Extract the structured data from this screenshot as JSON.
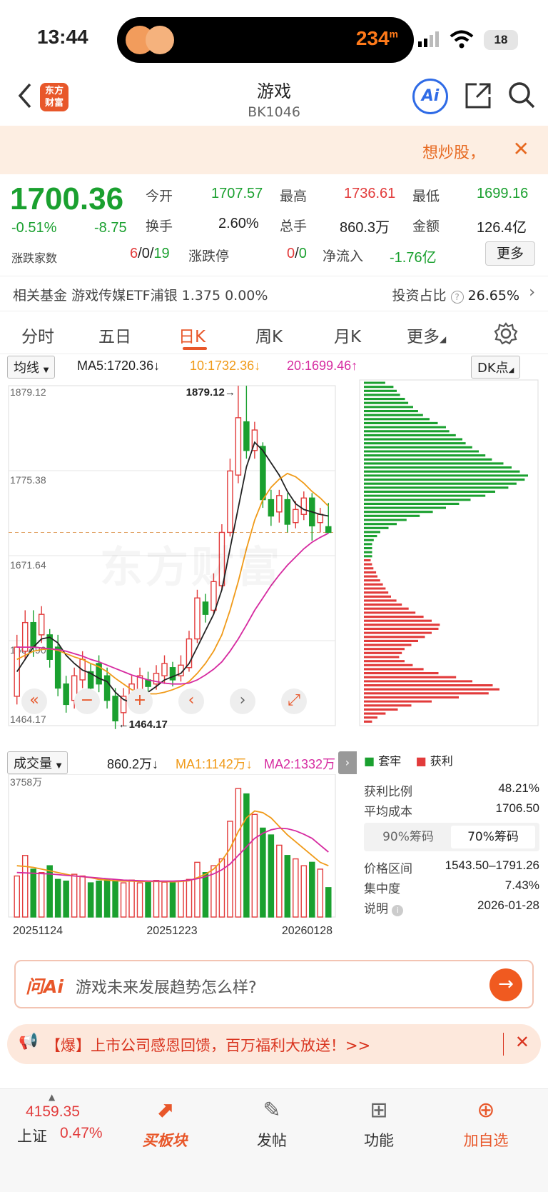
{
  "status_bar": {
    "time": "13:44",
    "speed": "234",
    "speed_unit": "m",
    "battery": "18"
  },
  "nav": {
    "title": "游戏",
    "code": "BK1046",
    "logo_line1": "东方",
    "logo_line2": "财富",
    "ai_label": "Ai"
  },
  "banner": {
    "text": "想炒股，",
    "close": "✕"
  },
  "quote": {
    "price": "1700.36",
    "change_pct": "-0.51%",
    "change": "-8.75",
    "open_label": "今开",
    "open": "1707.57",
    "high_label": "最高",
    "high": "1736.61",
    "low_label": "最低",
    "low": "1699.16",
    "turnover_label": "换手",
    "turnover": "2.60%",
    "volume_label": "总手",
    "volume": "860.3万",
    "amount_label": "金额",
    "amount": "126.4亿",
    "breadth_label": "涨跌家数",
    "breadth_up": "6",
    "breadth_flat": "0",
    "breadth_down": "19",
    "limit_label": "涨跌停",
    "limit_up": "0",
    "limit_down": "0",
    "netflow_label": "净流入",
    "netflow": "-1.76亿",
    "more": "更多",
    "sep": "/"
  },
  "fund": {
    "label": "相关基金",
    "name": "游戏传媒ETF浦银 1.375 0.00%",
    "ratio_label": "投资占比",
    "ratio": "26.65%"
  },
  "tabs": [
    "分时",
    "五日",
    "日K",
    "周K",
    "月K",
    "更多"
  ],
  "active_tab": "日K",
  "kline": {
    "indicator_select": "均线",
    "ma5": "MA5:1720.36↓",
    "ma10": "10:1732.36↓",
    "ma20": "20:1699.46↑",
    "dk_select": "DK点",
    "y_labels": [
      "1879.12",
      "1775.38",
      "1671.64",
      "1567.90",
      "1464.17"
    ],
    "high_mark": "1879.12→",
    "low_mark": "←1464.17",
    "watermark": "东方财富"
  },
  "volume": {
    "select": "成交量",
    "vol": "860.2万↓",
    "ma1": "MA1:1142万↓",
    "ma2": "MA2:1332万",
    "max_label": "3758万",
    "dates": [
      "20251124",
      "20251223",
      "20260128"
    ]
  },
  "chips": {
    "legend_trap": "套牢",
    "legend_profit": "获利",
    "profit_ratio_label": "获利比例",
    "profit_ratio": "48.21%",
    "avg_cost_label": "平均成本",
    "avg_cost": "1706.50",
    "tab90": "90%筹码",
    "tab70": "70%筹码",
    "range_label": "价格区间",
    "range": "1543.50–1791.26",
    "concentration_label": "集中度",
    "concentration": "7.43%",
    "note_label": "说明",
    "note_date": "2026-01-28"
  },
  "ask": {
    "brand": "问Ai",
    "question": "游戏未来发展趋势怎么样?",
    "go": "→"
  },
  "promo": {
    "text": "【爆】上市公司感恩回馈，百万福利大放送！>>",
    "close": "✕"
  },
  "bottom": {
    "index_value": "4159.35",
    "index_name": "上证",
    "index_change": "0.47%",
    "buy_block": "买板块",
    "post": "发帖",
    "func": "功能",
    "add": "加自选"
  },
  "chart_data": {
    "type": "candlestick",
    "title": "",
    "ylim": [
      1464.17,
      1879.12
    ],
    "candles": [
      {
        "o": 1500,
        "c": 1560,
        "h": 1575,
        "l": 1490
      },
      {
        "o": 1555,
        "c": 1590,
        "h": 1605,
        "l": 1545
      },
      {
        "o": 1590,
        "c": 1560,
        "h": 1605,
        "l": 1548
      },
      {
        "o": 1575,
        "c": 1600,
        "h": 1610,
        "l": 1565
      },
      {
        "o": 1575,
        "c": 1545,
        "h": 1582,
        "l": 1535
      },
      {
        "o": 1560,
        "c": 1510,
        "h": 1575,
        "l": 1500
      },
      {
        "o": 1515,
        "c": 1490,
        "h": 1525,
        "l": 1480
      },
      {
        "o": 1495,
        "c": 1525,
        "h": 1535,
        "l": 1485
      },
      {
        "o": 1520,
        "c": 1545,
        "h": 1555,
        "l": 1510
      },
      {
        "o": 1530,
        "c": 1510,
        "h": 1540,
        "l": 1500
      },
      {
        "o": 1540,
        "c": 1515,
        "h": 1550,
        "l": 1505
      },
      {
        "o": 1525,
        "c": 1495,
        "h": 1535,
        "l": 1485
      },
      {
        "o": 1500,
        "c": 1470,
        "h": 1510,
        "l": 1460
      },
      {
        "o": 1480,
        "c": 1500,
        "h": 1510,
        "l": 1464
      },
      {
        "o": 1495,
        "c": 1515,
        "h": 1525,
        "l": 1485
      },
      {
        "o": 1505,
        "c": 1525,
        "h": 1535,
        "l": 1495
      },
      {
        "o": 1520,
        "c": 1512,
        "h": 1530,
        "l": 1505
      },
      {
        "o": 1515,
        "c": 1528,
        "h": 1538,
        "l": 1508
      },
      {
        "o": 1525,
        "c": 1540,
        "h": 1550,
        "l": 1515
      },
      {
        "o": 1535,
        "c": 1520,
        "h": 1542,
        "l": 1512
      },
      {
        "o": 1525,
        "c": 1538,
        "h": 1550,
        "l": 1518
      },
      {
        "o": 1535,
        "c": 1570,
        "h": 1580,
        "l": 1530
      },
      {
        "o": 1570,
        "c": 1620,
        "h": 1630,
        "l": 1565
      },
      {
        "o": 1615,
        "c": 1600,
        "h": 1625,
        "l": 1590
      },
      {
        "o": 1605,
        "c": 1640,
        "h": 1650,
        "l": 1600
      },
      {
        "o": 1635,
        "c": 1700,
        "h": 1710,
        "l": 1630
      },
      {
        "o": 1700,
        "c": 1775,
        "h": 1790,
        "l": 1695
      },
      {
        "o": 1770,
        "c": 1840,
        "h": 1879,
        "l": 1760
      },
      {
        "o": 1835,
        "c": 1800,
        "h": 1879,
        "l": 1790
      },
      {
        "o": 1800,
        "c": 1825,
        "h": 1835,
        "l": 1790
      },
      {
        "o": 1805,
        "c": 1740,
        "h": 1810,
        "l": 1730
      },
      {
        "o": 1740,
        "c": 1720,
        "h": 1752,
        "l": 1708
      },
      {
        "o": 1725,
        "c": 1745,
        "h": 1752,
        "l": 1712
      },
      {
        "o": 1740,
        "c": 1710,
        "h": 1748,
        "l": 1700
      },
      {
        "o": 1712,
        "c": 1728,
        "h": 1738,
        "l": 1705
      },
      {
        "o": 1722,
        "c": 1742,
        "h": 1750,
        "l": 1715
      },
      {
        "o": 1742,
        "c": 1708,
        "h": 1748,
        "l": 1690
      },
      {
        "o": 1712,
        "c": 1722,
        "h": 1730,
        "l": 1700
      },
      {
        "o": 1707,
        "c": 1700,
        "h": 1736,
        "l": 1699
      }
    ],
    "ma5": [
      1530,
      1545,
      1560,
      1570,
      1572,
      1565,
      1550,
      1540,
      1532,
      1528,
      1522,
      1518,
      1505,
      1496,
      1492,
      1500,
      1505,
      1512,
      1520,
      1524,
      1528,
      1540,
      1560,
      1580,
      1600,
      1630,
      1680,
      1730,
      1780,
      1810,
      1800,
      1785,
      1770,
      1750,
      1735,
      1728,
      1725,
      1722,
      1720
    ],
    "ma10": [
      1545,
      1550,
      1555,
      1557,
      1558,
      1556,
      1552,
      1548,
      1545,
      1540,
      1536,
      1530,
      1522,
      1515,
      1508,
      1505,
      1503,
      1503,
      1505,
      1508,
      1512,
      1518,
      1528,
      1540,
      1555,
      1575,
      1605,
      1640,
      1680,
      1715,
      1740,
      1755,
      1765,
      1772,
      1768,
      1760,
      1750,
      1742,
      1732
    ],
    "ma20": [
      1560,
      1560,
      1560,
      1559,
      1558,
      1557,
      1555,
      1552,
      1549,
      1545,
      1542,
      1538,
      1534,
      1530,
      1526,
      1523,
      1520,
      1518,
      1516,
      1515,
      1515,
      1516,
      1520,
      1526,
      1533,
      1542,
      1555,
      1570,
      1587,
      1605,
      1620,
      1635,
      1648,
      1660,
      1670,
      1680,
      1688,
      1694,
      1699
    ],
    "volume_max": 3758,
    "volume": [
      1200,
      1800,
      1400,
      1300,
      1500,
      1100,
      1050,
      1250,
      1200,
      1000,
      1050,
      1100,
      1050,
      1000,
      1080,
      1000,
      1050,
      1070,
      1020,
      1000,
      1050,
      1100,
      1600,
      1300,
      1500,
      1700,
      2800,
      3758,
      3600,
      3000,
      2600,
      2400,
      2100,
      1800,
      1700,
      1500,
      1600,
      1400,
      860
    ],
    "vol_up": [
      true,
      true,
      false,
      true,
      false,
      false,
      false,
      true,
      true,
      false,
      false,
      false,
      false,
      true,
      true,
      true,
      false,
      true,
      true,
      false,
      true,
      true,
      true,
      false,
      true,
      true,
      true,
      true,
      false,
      true,
      false,
      false,
      true,
      false,
      true,
      true,
      false,
      true,
      false
    ],
    "vol_ma1": [
      1500,
      1480,
      1450,
      1400,
      1350,
      1300,
      1250,
      1200,
      1180,
      1150,
      1100,
      1080,
      1060,
      1050,
      1050,
      1040,
      1040,
      1040,
      1035,
      1030,
      1040,
      1060,
      1150,
      1250,
      1400,
      1650,
      2000,
      2500,
      2900,
      3100,
      3050,
      2900,
      2650,
      2400,
      2200,
      2000,
      1800,
      1600,
      1500
    ],
    "vol_ma2": [
      1300,
      1290,
      1280,
      1270,
      1260,
      1240,
      1220,
      1200,
      1180,
      1160,
      1140,
      1120,
      1100,
      1080,
      1070,
      1060,
      1055,
      1050,
      1050,
      1050,
      1060,
      1080,
      1120,
      1180,
      1260,
      1380,
      1550,
      1800,
      2050,
      2300,
      2450,
      2550,
      2600,
      2580,
      2520,
      2420,
      2300,
      2100,
      1900
    ],
    "chip_profit": [
      0.13,
      0.18,
      0.2,
      0.22,
      0.25,
      0.27,
      0.3,
      0.33,
      0.36,
      0.4,
      0.45,
      0.5,
      0.52,
      0.56,
      0.6,
      0.62,
      0.66,
      0.7,
      0.74,
      0.78,
      0.85,
      0.9,
      0.95,
      1.0,
      0.98,
      0.93,
      0.88,
      0.8,
      0.74,
      0.65,
      0.58,
      0.5,
      0.42,
      0.34,
      0.26,
      0.2,
      0.15,
      0.1,
      0.08,
      0.06,
      0.05,
      0.05,
      0.05,
      0.05
    ],
    "chip_trap": [
      0.05,
      0.06,
      0.07,
      0.09,
      0.1,
      0.12,
      0.14,
      0.16,
      0.18,
      0.2,
      0.24,
      0.28,
      0.33,
      0.38,
      0.44,
      0.5,
      0.56,
      0.55,
      0.5,
      0.45,
      0.4,
      0.35,
      0.3,
      0.28,
      0.26,
      0.3,
      0.36,
      0.44,
      0.55,
      0.68,
      0.8,
      0.95,
      1.0,
      0.92,
      0.7,
      0.5,
      0.35,
      0.25,
      0.16,
      0.1,
      0.06
    ]
  }
}
